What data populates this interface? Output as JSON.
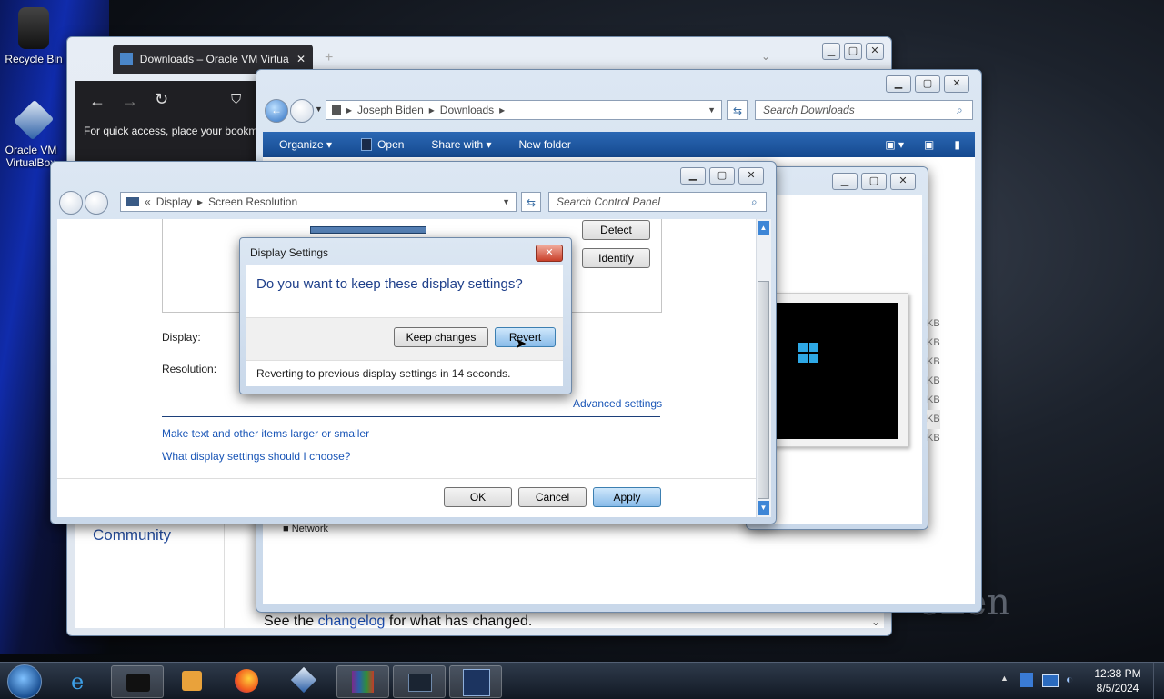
{
  "desktop": {
    "icons": [
      {
        "label": "Recycle Bin"
      },
      {
        "label": "Oracle VM VirtualBox"
      }
    ],
    "watermark": "eZen"
  },
  "browser": {
    "tab_title": "Downloads – Oracle VM Virtual",
    "new_tab": "+",
    "bookmark_notice": "For quick access, place your bookm",
    "community_link": "Community",
    "footer_prefix": "See the ",
    "footer_link": "changelog",
    "footer_suffix": " for what has changed."
  },
  "explorer": {
    "breadcrumb": [
      "Joseph Biden",
      "Downloads"
    ],
    "search_placeholder": "Search Downloads",
    "toolbar": {
      "organize": "Organize",
      "open": "Open",
      "share_with": "Share with",
      "new_folder": "New folder"
    },
    "nav_item": "Network"
  },
  "right_window": {
    "sizes": [
      "KB",
      "KB",
      "KB",
      "KB",
      "KB",
      "KB",
      "KB"
    ]
  },
  "control_panel": {
    "breadcrumb_prefix": "«",
    "breadcrumb": [
      "Display",
      "Screen Resolution"
    ],
    "search_placeholder": "Search Control Panel",
    "detect": "Detect",
    "identify": "Identify",
    "display_label": "Display:",
    "resolution_label": "Resolution:",
    "advanced_settings": "Advanced settings",
    "link_text_size": "Make text and other items larger or smaller",
    "link_choose": "What display settings should I choose?",
    "ok": "OK",
    "cancel": "Cancel",
    "apply": "Apply"
  },
  "dialog": {
    "title": "Display Settings",
    "question": "Do you want to keep these display settings?",
    "keep": "Keep changes",
    "revert": "Revert",
    "countdown": "Reverting to previous display settings in 14 seconds."
  },
  "taskbar": {
    "time": "12:38 PM",
    "date": "8/5/2024"
  }
}
